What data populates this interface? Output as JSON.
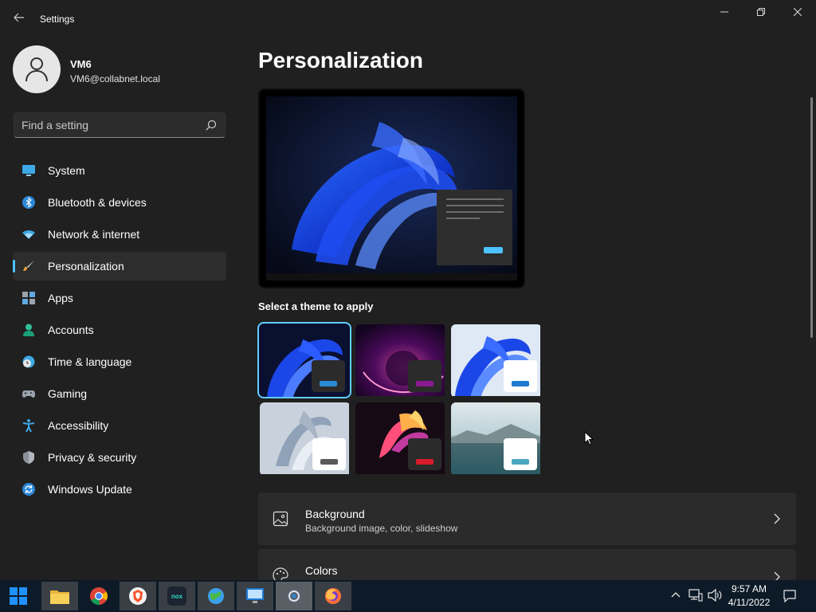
{
  "window": {
    "title": "Settings",
    "back_icon": "back-arrow-icon",
    "controls": [
      "minimize-icon",
      "restore-icon",
      "close-icon"
    ]
  },
  "user": {
    "name": "VM6",
    "email": "VM6@collabnet.local",
    "avatar_icon": "person-icon"
  },
  "search": {
    "placeholder": "Find a setting",
    "value": "",
    "icon": "search-icon"
  },
  "nav": {
    "active": "Personalization",
    "items": [
      {
        "label": "System",
        "icon": "monitor-icon"
      },
      {
        "label": "Bluetooth & devices",
        "icon": "bluetooth-icon"
      },
      {
        "label": "Network & internet",
        "icon": "wifi-icon"
      },
      {
        "label": "Personalization",
        "icon": "paintbrush-icon"
      },
      {
        "label": "Apps",
        "icon": "apps-icon"
      },
      {
        "label": "Accounts",
        "icon": "person-icon"
      },
      {
        "label": "Time & language",
        "icon": "globe-clock-icon"
      },
      {
        "label": "Gaming",
        "icon": "gamepad-icon"
      },
      {
        "label": "Accessibility",
        "icon": "accessibility-icon"
      },
      {
        "label": "Privacy & security",
        "icon": "shield-icon"
      },
      {
        "label": "Windows Update",
        "icon": "sync-icon"
      }
    ]
  },
  "main": {
    "title": "Personalization",
    "theme_section_label": "Select a theme to apply",
    "themes": [
      {
        "name": "windows-dark-bloom",
        "selected": true
      },
      {
        "name": "glow"
      },
      {
        "name": "windows-light-bloom"
      },
      {
        "name": "captured-motion"
      },
      {
        "name": "flow"
      },
      {
        "name": "sunrise"
      }
    ],
    "cards": [
      {
        "title": "Background",
        "subtitle": "Background image, color, slideshow",
        "icon": "picture-icon"
      },
      {
        "title": "Colors",
        "subtitle": "",
        "icon": "palette-icon"
      }
    ]
  },
  "taskbar": {
    "apps": [
      "start-icon",
      "file-explorer-icon",
      "chrome-icon",
      "brave-icon",
      "nox-icon",
      "maps-icon",
      "remote-desktop-icon",
      "settings-icon",
      "firefox-icon"
    ],
    "tray_icons": [
      "chevron-up-icon",
      "network-icon",
      "volume-icon",
      "notification-icon"
    ],
    "time": "9:57 AM",
    "date": "4/11/2022"
  },
  "colors": {
    "accent": "#4cc2ff",
    "background": "#202020",
    "card": "#2b2b2b",
    "taskbar": "#0d1b28"
  }
}
